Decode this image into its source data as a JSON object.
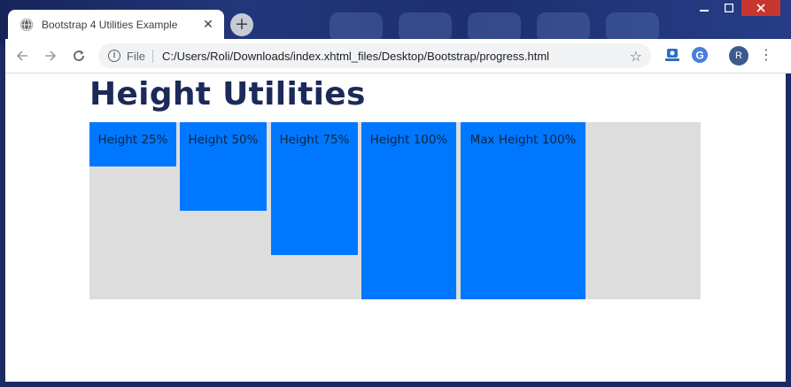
{
  "browser": {
    "tab_title": "Bootstrap 4 Utilities Example",
    "tab_close": "✕",
    "new_tab": "+",
    "file_label": "File",
    "url": "C:/Users/Roli/Downloads/index.xhtml_files/Desktop/Bootstrap/progress.html",
    "avatar_initial": "R",
    "icons": [
      "globe-icon",
      "back-arrow-icon",
      "forward-arrow-icon",
      "reload-icon",
      "info-icon",
      "star-icon",
      "extension-icon",
      "google-icon",
      "menu-dots-icon"
    ]
  },
  "page": {
    "heading": "Height Utilities",
    "boxes": [
      {
        "label": "Height 25%",
        "height_pct": 25
      },
      {
        "label": "Height 50%",
        "height_pct": 50
      },
      {
        "label": "Height 75%",
        "height_pct": 75
      },
      {
        "label": "Height 100%",
        "height_pct": 100
      },
      {
        "label": "Max Height 100%",
        "height_pct": 100
      }
    ],
    "colors": {
      "box": "#0077ff",
      "container": "#dddddd",
      "heading": "#1c2a5a"
    }
  }
}
